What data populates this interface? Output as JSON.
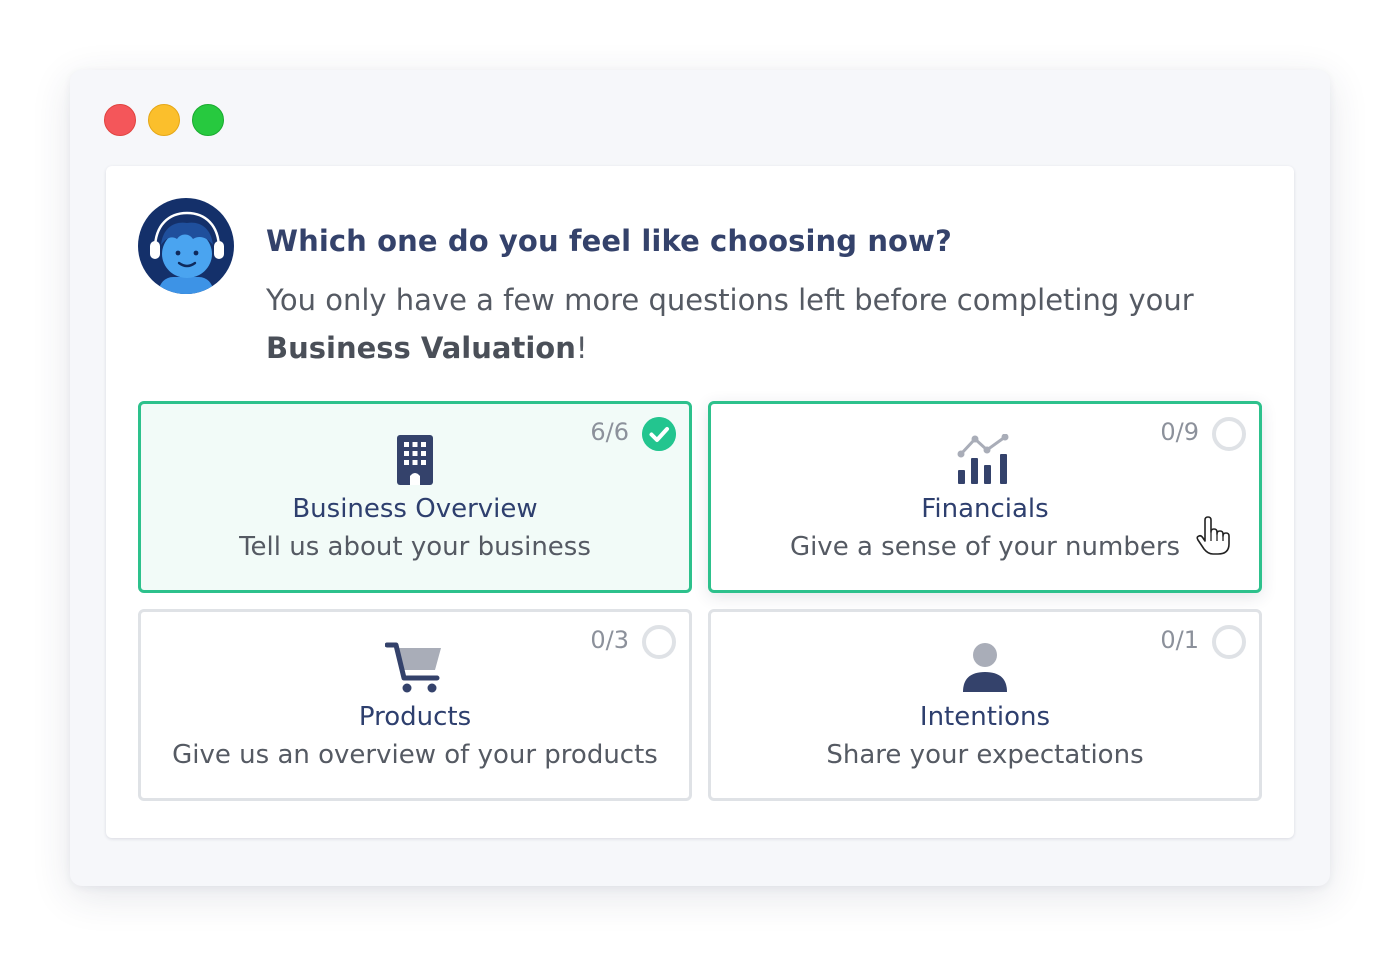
{
  "header": {
    "question": "Which one do you feel like choosing now?",
    "subtitle_prefix": "You only have a few more questions left before completing your ",
    "subtitle_bold": "Business Valuation",
    "subtitle_suffix": "!"
  },
  "cards": [
    {
      "title": "Business Overview",
      "description": "Tell us about your business",
      "progress": "6/6",
      "completed": 6,
      "total": 6,
      "icon": "building-icon",
      "state": "completed"
    },
    {
      "title": "Financials",
      "description": "Give a sense of your numbers",
      "progress": "0/9",
      "completed": 0,
      "total": 9,
      "icon": "chart-icon",
      "state": "hover"
    },
    {
      "title": "Products",
      "description": "Give us an overview of your products",
      "progress": "0/3",
      "completed": 0,
      "total": 3,
      "icon": "cart-icon",
      "state": "default"
    },
    {
      "title": "Intentions",
      "description": "Share your expectations",
      "progress": "0/1",
      "completed": 0,
      "total": 1,
      "icon": "person-icon",
      "state": "default"
    }
  ],
  "colors": {
    "accent_green": "#2dc18c",
    "title_navy": "#2e3f6e",
    "text_gray": "#555a63"
  }
}
